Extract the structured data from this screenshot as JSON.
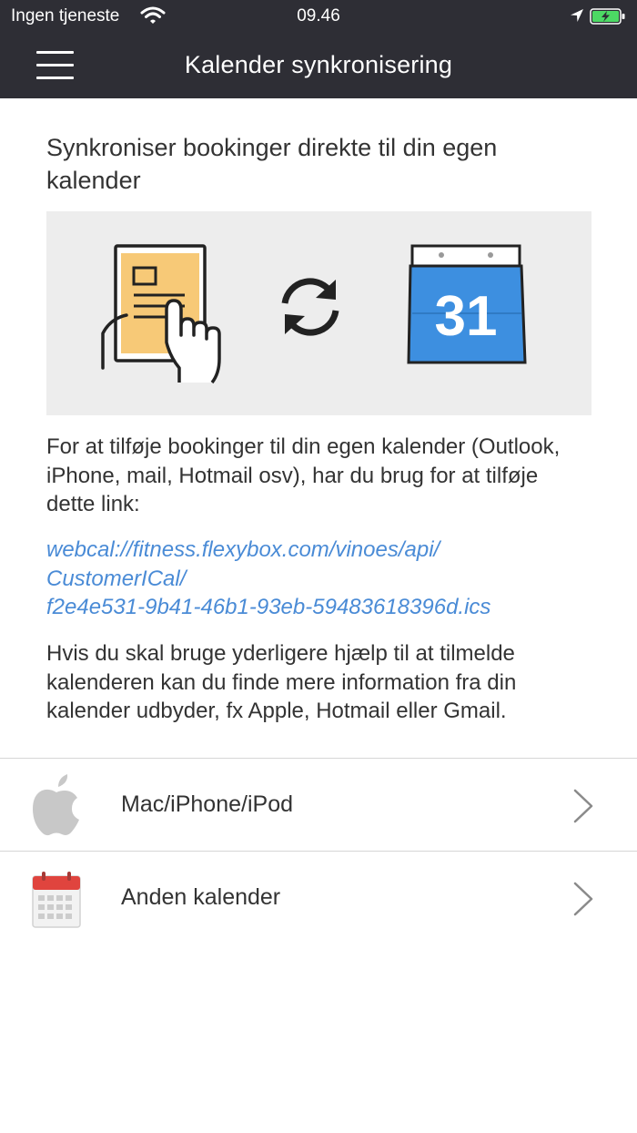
{
  "status_bar": {
    "carrier": "Ingen tjeneste",
    "time": "09.46",
    "icons": [
      "wifi-icon",
      "location-arrow-icon",
      "battery-charging-icon"
    ],
    "battery_color": "#4cd964"
  },
  "nav": {
    "title": "Kalender synkronisering",
    "menu_icon": "hamburger-menu-icon",
    "background": "#2e2e35"
  },
  "heading": "Synkroniser bookinger direkte til din egen kalender",
  "illustration": {
    "calendar_day": "31",
    "icons": [
      "tablet-touch-icon",
      "sync-icon",
      "calendar-icon"
    ]
  },
  "intro": "For at tilføje bookinger til din egen kalender (Outlook, iPhone, mail, Hotmail osv), har du brug for at tilføje dette link:",
  "link": {
    "line1": "webcal://fitness.flexybox.com/vinoes/api/",
    "line2": "CustomerICal/",
    "line3": "f2e4e531-9b41-46b1-93eb-59483618396d.ics",
    "color": "#4a8bd6"
  },
  "help": "Hvis du skal bruge yderligere hjælp til at tilmelde kalenderen kan du finde mere information fra din kalender udbyder, fx Apple, Hotmail eller Gmail.",
  "options": [
    {
      "label": "Mac/iPhone/iPod",
      "icon": "apple-logo-icon"
    },
    {
      "label": "Anden kalender",
      "icon": "calendar-icon"
    }
  ]
}
